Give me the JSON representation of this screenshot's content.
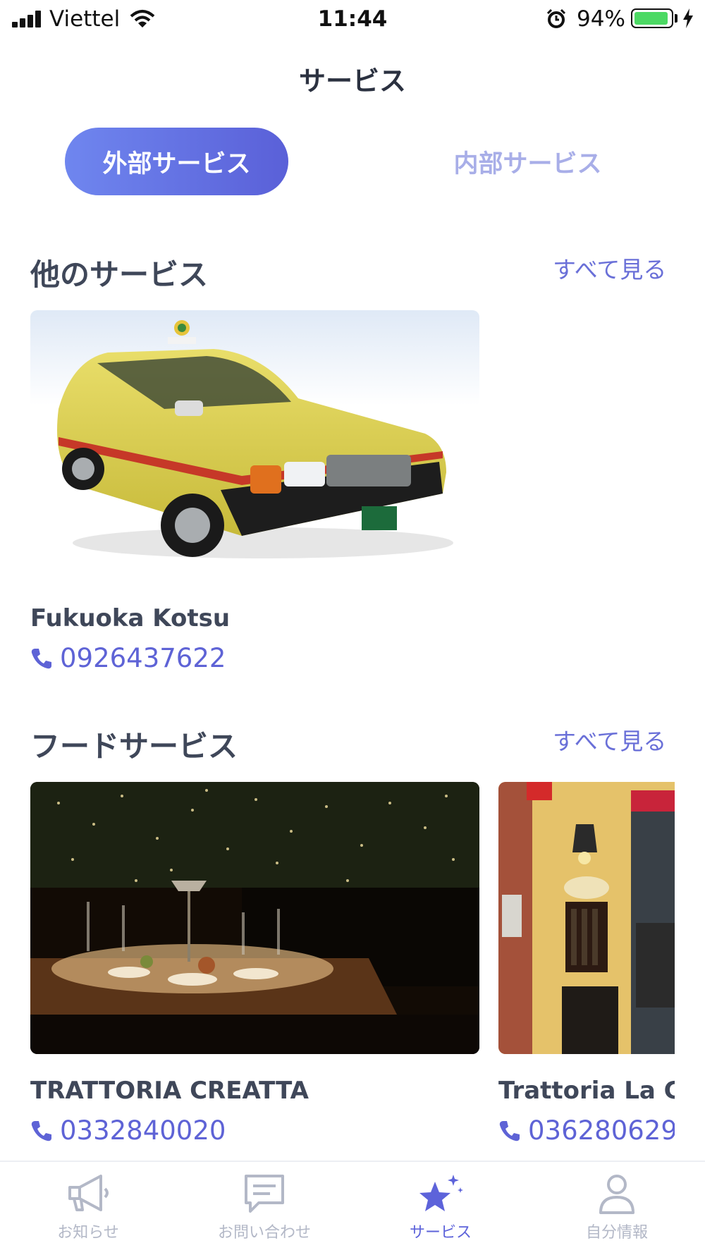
{
  "status_bar": {
    "carrier": "Viettel",
    "time": "11:44",
    "battery_percent": "94%",
    "battery_level": 0.94,
    "signal_icon": "signal-icon",
    "wifi_icon": "wifi-icon",
    "alarm_icon": "alarm-icon",
    "charging_icon": "bolt-icon"
  },
  "header": {
    "title": "サービス"
  },
  "segment": {
    "active_label": "外部サービス",
    "inactive_label": "内部サービス",
    "active_color": "#5f6cdf",
    "inactive_color": "#a8aee8"
  },
  "sections": [
    {
      "title": "他のサービス",
      "see_all": "すべて見る",
      "cards": [
        {
          "name": "Fukuoka Kotsu",
          "phone": "0926437622",
          "image": "taxi-photo"
        }
      ]
    },
    {
      "title": "フードサービス",
      "see_all": "すべて見る",
      "cards": [
        {
          "name": "TRATTORIA CREATTA",
          "phone": "0332840020",
          "image": "restaurant-dinner-photo"
        },
        {
          "name": "Trattoria La Gı",
          "phone": "036280629",
          "image": "restaurant-storefront-photo"
        }
      ]
    }
  ],
  "tabbar": {
    "items": [
      {
        "label": "お知らせ",
        "icon": "megaphone-icon"
      },
      {
        "label": "お問い合わせ",
        "icon": "chat-icon"
      },
      {
        "label": "サービス",
        "icon": "star-icon",
        "active": true
      },
      {
        "label": "自分情報",
        "icon": "user-icon"
      }
    ]
  },
  "accent_color": "#5e63d6"
}
